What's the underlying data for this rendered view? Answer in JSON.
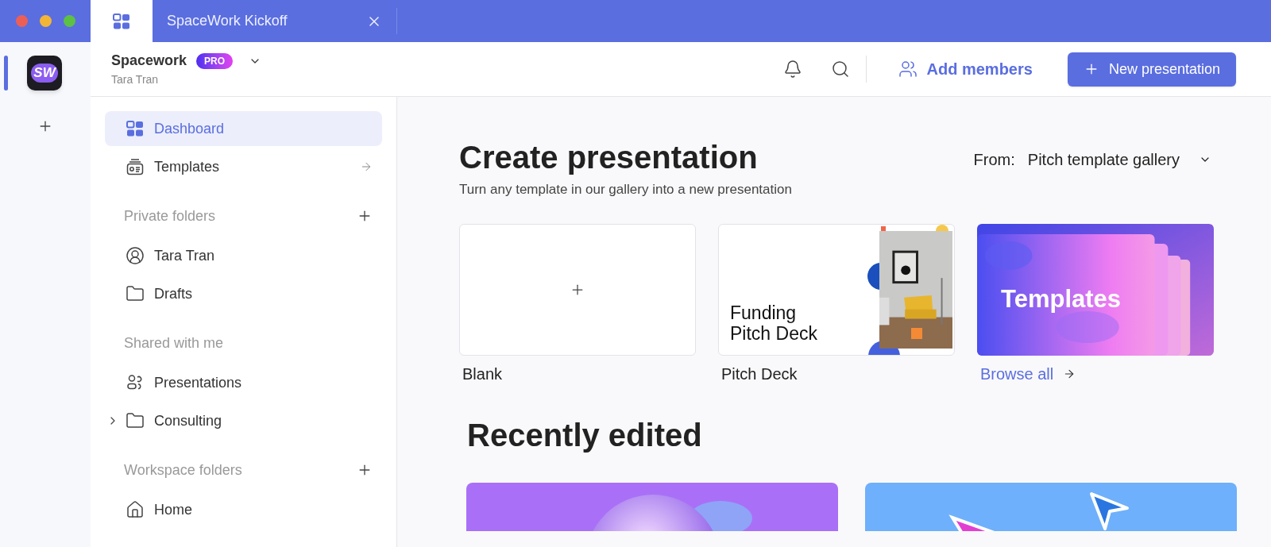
{
  "tabs": [
    {
      "kind": "home",
      "selected": true
    },
    {
      "kind": "document",
      "label": "SpaceWork Kickoff",
      "selected": false
    }
  ],
  "rail": {
    "logo": "SW",
    "selected": true
  },
  "header": {
    "workspace": "Spacework",
    "badge": "PRO",
    "user": "Tara Tran",
    "add_members": "Add members",
    "new_presentation": "New presentation"
  },
  "sidebar": {
    "items": [
      {
        "kind": "item",
        "label": "Dashboard",
        "selected": true
      },
      {
        "kind": "link",
        "label": "Templates",
        "selected": false
      },
      {
        "kind": "section",
        "label": "Private folders"
      },
      {
        "kind": "item",
        "label": "Tara Tran",
        "selected": false
      },
      {
        "kind": "item",
        "label": "Drafts",
        "selected": false
      },
      {
        "kind": "heading",
        "label": "Shared with me"
      },
      {
        "kind": "item",
        "label": "Presentations",
        "selected": false
      },
      {
        "kind": "folder",
        "label": "Consulting",
        "selected": false,
        "expanded": false
      },
      {
        "kind": "section",
        "label": "Workspace folders"
      },
      {
        "kind": "item",
        "label": "Home",
        "selected": false
      }
    ]
  },
  "create": {
    "title": "Create presentation",
    "subtitle": "Turn any template in our gallery into a new presentation",
    "source_label": "From:",
    "source": "Pitch template gallery",
    "cards": [
      {
        "kind": "blank",
        "label": "Blank"
      },
      {
        "kind": "slide",
        "label": "Pitch Deck",
        "slide_title": "Funding Pitch Deck"
      },
      {
        "kind": "gallery",
        "label": "Browse all",
        "banner": "Templates"
      }
    ]
  },
  "recent": {
    "title": "Recently edited"
  }
}
